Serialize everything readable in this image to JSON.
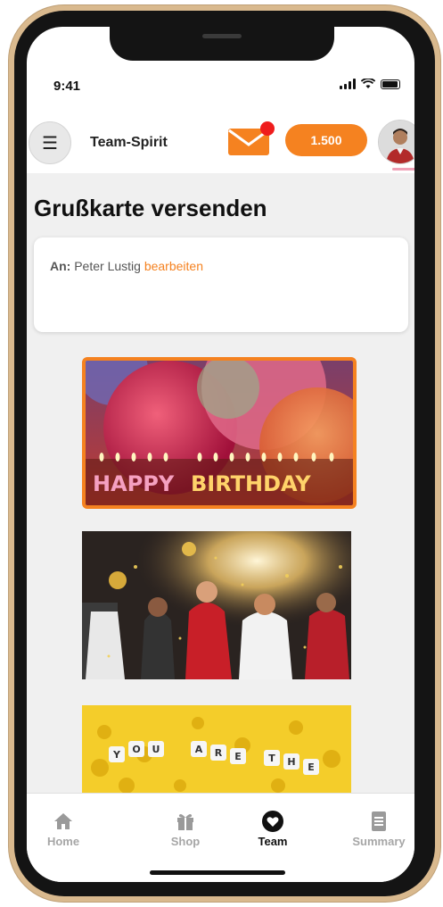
{
  "status_bar": {
    "time": "9:41"
  },
  "header": {
    "menu_icon": "hamburger-icon",
    "title": "Team-Spirit",
    "mail_icon": "envelope-icon",
    "coins": "1.500",
    "colors": {
      "accent": "#f58220",
      "notification": "#ef1d1d"
    }
  },
  "page": {
    "title": "Grußkarte versenden",
    "recipient": {
      "label": "An:",
      "name": "Peter Lustig",
      "edit": "bearbeiten"
    },
    "cards": [
      {
        "id": "happy-birthday",
        "text": "HAPPY BIRTHDAY",
        "selected": true
      },
      {
        "id": "party-crowd",
        "selected": false
      },
      {
        "id": "you-are-the",
        "text": "YOU ARE THE",
        "selected": false
      }
    ]
  },
  "tabbar": {
    "tabs": [
      {
        "label": "Home",
        "icon": "house-icon",
        "active": false
      },
      {
        "label": "Shop",
        "icon": "gift-icon",
        "active": false
      },
      {
        "label": "Team",
        "icon": "heart-icon",
        "active": true
      },
      {
        "label": "Summary",
        "icon": "document-icon",
        "active": false
      }
    ]
  }
}
